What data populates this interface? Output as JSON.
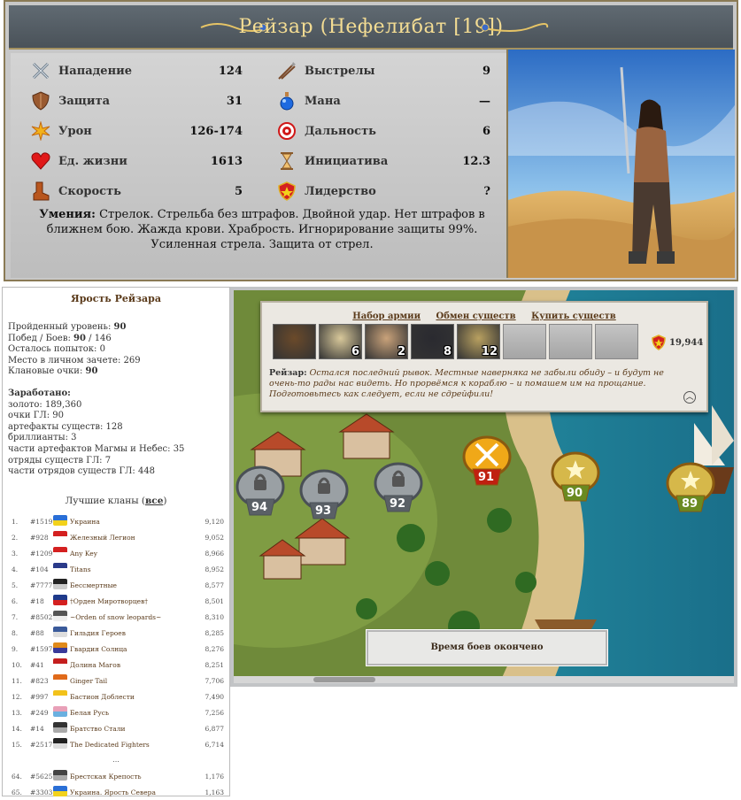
{
  "card": {
    "title": "Рейзар  (Нефелибат [19])",
    "stats_left": [
      {
        "label": "Нападение",
        "value": "124",
        "icon": "swords-icon"
      },
      {
        "label": "Защита",
        "value": "31",
        "icon": "shield-icon"
      },
      {
        "label": "Урон",
        "value": "126-174",
        "icon": "damage-burst-icon"
      },
      {
        "label": "Ед. жизни",
        "value": "1613",
        "icon": "heart-icon"
      },
      {
        "label": "Скорость",
        "value": "5",
        "icon": "boot-icon"
      }
    ],
    "stats_right": [
      {
        "label": "Выстрелы",
        "value": "9",
        "icon": "arrows-icon"
      },
      {
        "label": "Мана",
        "value": "—",
        "icon": "mana-potion-icon"
      },
      {
        "label": "Дальность",
        "value": "6",
        "icon": "target-icon"
      },
      {
        "label": "Инициатива",
        "value": "12.3",
        "icon": "hourglass-icon"
      },
      {
        "label": "Лидерство",
        "value": "?",
        "icon": "leadership-badge-icon"
      }
    ],
    "abilities_label": "Умения:",
    "abilities_text": "Стрелок. Стрельба без штрафов. Двойной удар. Нет штрафов в ближнем бою. Жажда крови. Храбрость. Игнорирование защиты 99%. Усиленная стрела. Защита от стрел."
  },
  "left": {
    "title": "Ярость Рейзара",
    "lines": [
      {
        "label": "Пройденный уровень:",
        "value": "90"
      },
      {
        "label": "Побед / Боев:",
        "value": "90",
        "extra": " / 146"
      },
      {
        "label": "Осталось попыток:",
        "value": "0",
        "plain": true
      },
      {
        "label": "Место в личном зачете:",
        "value": "269",
        "plain": true
      },
      {
        "label": "Клановые очки:",
        "value": "90"
      }
    ],
    "earned_title": "Заработано:",
    "earned": [
      "золото: 189,360",
      "очки ГЛ: 90",
      "артефакты существ: 128",
      "бриллианты: 3",
      "части артефактов Магмы и Небес: 35",
      "отряды существ ГЛ: 7",
      "части отрядов существ ГЛ: 448"
    ],
    "clans_title": "Лучшие кланы",
    "clans_link": "все",
    "clans": [
      {
        "rank": "1.",
        "id": "#1519",
        "name": "Украина",
        "points": "9,120",
        "color": "#2a6fd6",
        "color2": "#f2d21b"
      },
      {
        "rank": "2.",
        "id": "#928",
        "name": "Железный Легион",
        "points": "9,052",
        "color": "#d42020",
        "color2": "#ffffff"
      },
      {
        "rank": "3.",
        "id": "#1209",
        "name": "Any Key",
        "points": "8,966",
        "color": "#d42020",
        "color2": "#ffffff"
      },
      {
        "rank": "4.",
        "id": "#104",
        "name": "Titans",
        "points": "8,952",
        "color": "#2a3a8a",
        "color2": "#ffffff"
      },
      {
        "rank": "5.",
        "id": "#7777",
        "name": "Бессмертные",
        "points": "8,577",
        "color": "#222222",
        "color2": "#cccccc"
      },
      {
        "rank": "6.",
        "id": "#18",
        "name": "†Орден Миротворцев†",
        "points": "8,501",
        "color": "#1e3a8a",
        "color2": "#d42020"
      },
      {
        "rank": "7.",
        "id": "#8502",
        "name": "~Orden of snow leopards~",
        "points": "8,310",
        "color": "#555555",
        "color2": "#eeeeee"
      },
      {
        "rank": "8.",
        "id": "#88",
        "name": "Гильдия Героев",
        "points": "8,285",
        "color": "#3a5a9a",
        "color2": "#dddddd"
      },
      {
        "rank": "9.",
        "id": "#1597",
        "name": "Гвардия Солнца",
        "points": "8,276",
        "color": "#e08a1a",
        "color2": "#3a3a9a"
      },
      {
        "rank": "10.",
        "id": "#41",
        "name": "Долина Магов",
        "points": "8,251",
        "color": "#c41e1e",
        "color2": "#ffffff"
      },
      {
        "rank": "11.",
        "id": "#823",
        "name": "Ginger Tail",
        "points": "7,706",
        "color": "#e06a1a",
        "color2": "#ffffff"
      },
      {
        "rank": "12.",
        "id": "#997",
        "name": "Бастион Доблести",
        "points": "7,490",
        "color": "#f2c21b",
        "color2": "#ffffff"
      },
      {
        "rank": "13.",
        "id": "#249",
        "name": "Белая Русь",
        "points": "7,256",
        "color": "#e8a0b8",
        "color2": "#6ab0e0"
      },
      {
        "rank": "14.",
        "id": "#14",
        "name": "Братство Стали",
        "points": "6,877",
        "color": "#333333",
        "color2": "#aaaaaa"
      },
      {
        "rank": "15.",
        "id": "#2517",
        "name": "The Dedicated Fighters",
        "points": "6,714",
        "color": "#222222",
        "color2": "#dddddd"
      }
    ],
    "clans_ellipsis": "...",
    "clans_after": [
      {
        "rank": "64.",
        "id": "#5625",
        "name": "Брестская Крепость",
        "points": "1,176",
        "color": "#444444",
        "color2": "#aaaaaa"
      },
      {
        "rank": "65.",
        "id": "#3303",
        "name": "Украина. Ярость Севера",
        "points": "1,163",
        "color": "#2a6fd6",
        "color2": "#f2d21b"
      }
    ]
  },
  "map": {
    "links": [
      "Набор армии",
      "Обмен существ",
      "Купить существ"
    ],
    "army": [
      {
        "count": "",
        "color": "#6b4a2a",
        "icon": "raizar-portrait-icon"
      },
      {
        "count": "6",
        "color": "#d8c89a",
        "icon": "dwarf-icon"
      },
      {
        "count": "2",
        "color": "#c9a27a",
        "icon": "elder-icon"
      },
      {
        "count": "8",
        "color": "#2a2a30",
        "icon": "dark-knight-icon"
      },
      {
        "count": "12",
        "color": "#b8a060",
        "icon": "paladin-icon"
      }
    ],
    "gold": "19,944",
    "speaker": "Рейзар:",
    "dialog": "Остался последний рывок. Местные наверняка не забыли обиду – и будут не очень-то рады нас видеть. Но прорвёмся к кораблю – и помашем им на прощание. Подготовьтесь как следует, если не сдрейфили!",
    "levels": [
      {
        "num": "94",
        "state": "locked"
      },
      {
        "num": "93",
        "state": "locked"
      },
      {
        "num": "92",
        "state": "locked"
      },
      {
        "num": "91",
        "state": "current"
      },
      {
        "num": "90",
        "state": "done"
      },
      {
        "num": "89",
        "state": "done"
      }
    ],
    "status": "Время боев окончено"
  },
  "colors": {
    "title_gold": "#f3dc93",
    "link_brown": "#5a3a1a",
    "header_slate": "#555e66"
  }
}
